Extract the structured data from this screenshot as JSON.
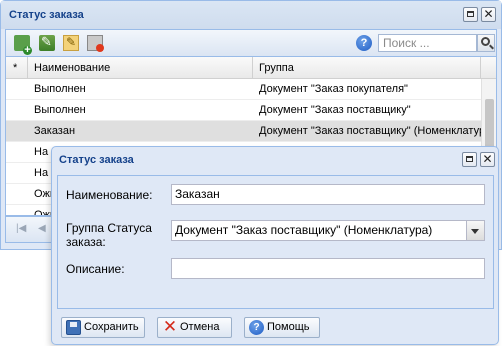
{
  "window": {
    "title": "Статус заказа"
  },
  "toolbar": {
    "search_placeholder": "Поиск ..."
  },
  "grid": {
    "marker_header": "*",
    "columns": [
      "Наименование",
      "Группа"
    ],
    "rows": [
      [
        "Выполнен",
        "Документ \"Заказ покупателя\""
      ],
      [
        "Выполнен",
        "Документ \"Заказ поставщику\""
      ],
      [
        "Заказан",
        "Документ \"Заказ поставщику\" (Номенклатура)"
      ],
      [
        "На с",
        ""
      ],
      [
        "На с",
        ""
      ],
      [
        "Ожи",
        ""
      ],
      [
        "Ожи",
        ""
      ]
    ],
    "selected_row": 2
  },
  "dialog": {
    "title": "Статус заказа",
    "name_label": "Наименование:",
    "name_value": "Заказан",
    "group_label": "Группа Статуса заказа:",
    "group_value": "Документ \"Заказ поставщику\" (Номенклатура)",
    "desc_label": "Описание:",
    "desc_value": "",
    "save_label": "Сохранить",
    "cancel_label": "Отмена",
    "help_label": "Помощь"
  }
}
